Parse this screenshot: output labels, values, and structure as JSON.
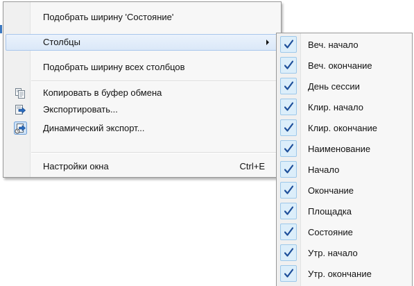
{
  "context_menu": {
    "items": [
      {
        "label": "Подобрать ширину 'Состояние'"
      },
      {
        "label": "Столбцы"
      },
      {
        "label": "Подобрать ширину всех столбцов"
      },
      {
        "label": "Копировать в буфер обмена",
        "icon": "copy-icon"
      },
      {
        "label": "Экспортировать...",
        "icon": "export-icon"
      },
      {
        "label": "Динамический экспорт...",
        "icon": "dynamic-export-icon"
      },
      {
        "label": "Настройки окна",
        "shortcut": "Ctrl+E"
      }
    ]
  },
  "columns_submenu": {
    "items": [
      {
        "label": "Веч. начало",
        "checked": true
      },
      {
        "label": "Веч. окончание",
        "checked": true
      },
      {
        "label": "День сессии",
        "checked": true
      },
      {
        "label": "Клир. начало",
        "checked": true
      },
      {
        "label": "Клир. окончание",
        "checked": true
      },
      {
        "label": "Наименование",
        "checked": true
      },
      {
        "label": "Начало",
        "checked": true
      },
      {
        "label": "Окончание",
        "checked": true
      },
      {
        "label": "Площадка",
        "checked": true
      },
      {
        "label": "Состояние",
        "checked": true
      },
      {
        "label": "Утр. начало",
        "checked": true
      },
      {
        "label": "Утр. окончание",
        "checked": true
      }
    ]
  },
  "colors": {
    "menu_bg": "#f7f7f7",
    "highlight": "#dbe8f8",
    "check_bg": "#dceefa",
    "check_mark": "#1e4f9a"
  }
}
